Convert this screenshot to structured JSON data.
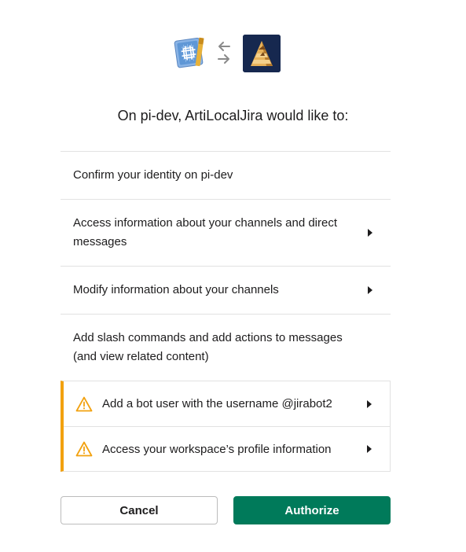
{
  "header": {
    "left_icon": "xcode-app-icon",
    "swap_icon": "swap-arrows-icon",
    "right_icon": "artilocaljira-app-icon"
  },
  "title": "On pi-dev, ArtiLocalJira would like to:",
  "permissions": [
    {
      "label": "Confirm your identity on pi-dev",
      "expandable": false
    },
    {
      "label": "Access information about your channels and direct messages",
      "expandable": true
    },
    {
      "label": "Modify information about your channels",
      "expandable": true
    },
    {
      "label": "Add slash commands and add actions to messages (and view related content)",
      "expandable": false
    }
  ],
  "warnings": [
    {
      "label": "Add a bot user with the username @jirabot2",
      "icon": "warning-icon",
      "expandable": true
    },
    {
      "label": "Access your workspace’s profile information",
      "icon": "warning-icon",
      "expandable": true
    }
  ],
  "buttons": {
    "cancel_label": "Cancel",
    "authorize_label": "Authorize"
  },
  "colors": {
    "authorize": "#007a5a",
    "warning_accent": "#f2a10f",
    "divider": "#e2e2e2"
  }
}
